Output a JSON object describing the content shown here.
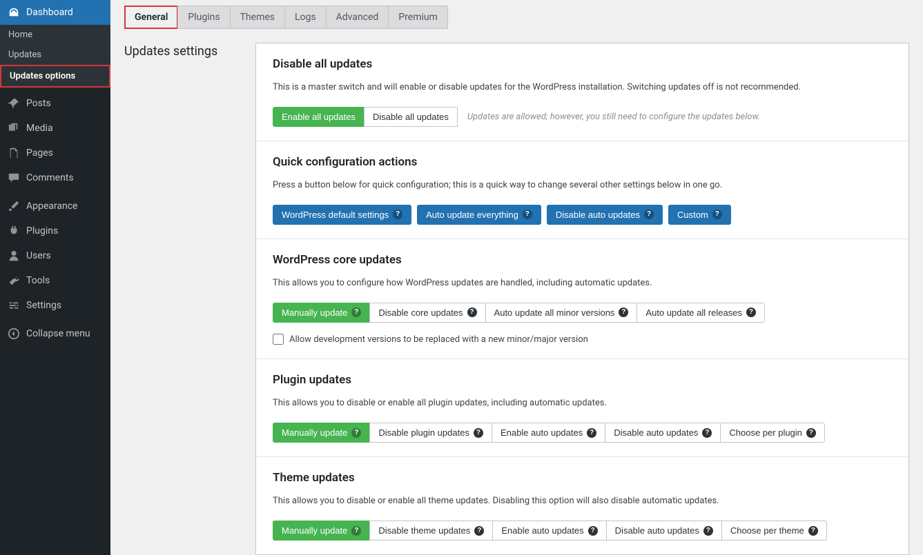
{
  "sidebar": {
    "dashboard": "Dashboard",
    "home": "Home",
    "updates": "Updates",
    "updates_options": "Updates options",
    "posts": "Posts",
    "media": "Media",
    "pages": "Pages",
    "comments": "Comments",
    "appearance": "Appearance",
    "plugins": "Plugins",
    "users": "Users",
    "tools": "Tools",
    "settings": "Settings",
    "collapse": "Collapse menu"
  },
  "tabs": [
    "General",
    "Plugins",
    "Themes",
    "Logs",
    "Advanced",
    "Premium"
  ],
  "page_title": "Updates settings",
  "sections": {
    "disable_all": {
      "title": "Disable all updates",
      "desc": "This is a master switch and will enable or disable updates for the WordPress installation. Switching updates off is not recommended.",
      "enable": "Enable all updates",
      "disable": "Disable all updates",
      "hint": "Updates are allowed; however, you still need to configure the updates below."
    },
    "quick": {
      "title": "Quick configuration actions",
      "desc": "Press a button below for quick configuration; this is a quick way to change several other settings below in one go.",
      "b1": "WordPress default settings",
      "b2": "Auto update everything",
      "b3": "Disable auto updates",
      "b4": "Custom"
    },
    "core": {
      "title": "WordPress core updates",
      "desc": "This allows you to configure how WordPress updates are handled, including automatic updates.",
      "b1": "Manually update",
      "b2": "Disable core updates",
      "b3": "Auto update all minor versions",
      "b4": "Auto update all releases",
      "check": "Allow development versions to be replaced with a new minor/major version"
    },
    "plugin": {
      "title": "Plugin updates",
      "desc": "This allows you to disable or enable all plugin updates, including automatic updates.",
      "b1": "Manually update",
      "b2": "Disable plugin updates",
      "b3": "Enable auto updates",
      "b4": "Disable auto updates",
      "b5": "Choose per plugin"
    },
    "theme": {
      "title": "Theme updates",
      "desc": "This allows you to disable or enable all theme updates. Disabling this option will also disable automatic updates.",
      "b1": "Manually update",
      "b2": "Disable theme updates",
      "b3": "Enable auto updates",
      "b4": "Disable auto updates",
      "b5": "Choose per theme"
    }
  }
}
